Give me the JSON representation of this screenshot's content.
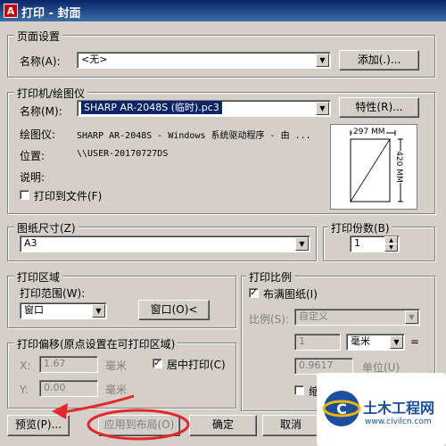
{
  "window": {
    "title": "打印 - 封面",
    "app_icon": "A"
  },
  "page_setup": {
    "group_label": "页面设置",
    "name_label": "名称(A):",
    "name_value": "<无>",
    "add_button": "添加(.)..."
  },
  "printer": {
    "group_label": "打印机/绘图仪",
    "name_label": "名称(M):",
    "name_value": "SHARP AR-2048S (临时).pc3",
    "properties_button": "特性(R)...",
    "plotter_label": "绘图仪:",
    "plotter_value": "SHARP AR-2048S - Windows 系统驱动程序 - 由 ...",
    "location_label": "位置:",
    "location_value": "\\\\USER-20170727DS",
    "description_label": "说明:",
    "print_to_file_label": "打印到文件(F)",
    "print_to_file_checked": false,
    "preview_width_label": "297 MM",
    "preview_height_label": "420 MM"
  },
  "paper_size": {
    "group_label": "图纸尺寸(Z)",
    "value": "A3"
  },
  "copies": {
    "group_label": "打印份数(B)",
    "value": "1"
  },
  "plot_area": {
    "group_label": "打印区域",
    "range_label": "打印范围(W):",
    "range_value": "窗口",
    "window_button": "窗口(O)<"
  },
  "plot_scale": {
    "group_label": "打印比例",
    "fit_label": "布满图纸(I)",
    "fit_checked": true,
    "scale_label": "比例(S):",
    "scale_value": "自定义",
    "value1": "1",
    "unit1": "毫米",
    "equals": "=",
    "value2": "0.9617",
    "unit2_label": "单位(U)",
    "lineweights_label": "缩"
  },
  "plot_offset": {
    "group_label": "打印偏移(原点设置在可打印区域)",
    "x_label": "X:",
    "x_value": "1.67",
    "x_unit": "毫米",
    "y_label": "Y:",
    "y_value": "0.00",
    "y_unit": "毫米",
    "center_label": "居中打印(C)",
    "center_checked": true
  },
  "buttons": {
    "preview": "预览(P)...",
    "apply_layout": "应用到布局(O)",
    "ok": "确定",
    "cancel": "取消"
  },
  "watermark": {
    "text": "土木工程网",
    "url": "www.civilcn.com"
  },
  "colors": {
    "annotation": "#e0282e",
    "titlebar": "#0a246a"
  }
}
